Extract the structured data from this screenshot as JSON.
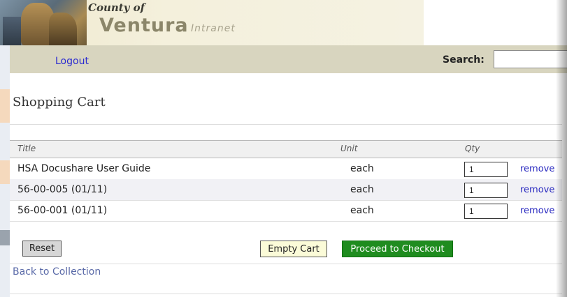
{
  "header": {
    "county": "County of",
    "ventura": "Ventura",
    "intranet": "Intranet"
  },
  "nav": {
    "logout": "Logout",
    "search_label": "Search:",
    "search_value": ""
  },
  "page": {
    "title": "Shopping Cart"
  },
  "table": {
    "headers": {
      "title": "Title",
      "unit": "Unit",
      "qty": "Qty"
    },
    "rows": [
      {
        "title": "HSA Docushare User Guide",
        "unit": "each",
        "qty": "1",
        "remove": "remove"
      },
      {
        "title": "56-00-005 (01/11)",
        "unit": "each",
        "qty": "1",
        "remove": "remove"
      },
      {
        "title": "56-00-001 (01/11)",
        "unit": "each",
        "qty": "1",
        "remove": "remove"
      }
    ]
  },
  "buttons": {
    "reset": "Reset",
    "empty_cart": "Empty Cart",
    "checkout": "Proceed to Checkout"
  },
  "links": {
    "back": "Back to Collection"
  },
  "colors": {
    "navbar": "#d8d5bf",
    "checkout": "#1f8c1f",
    "link": "#2a2ac0"
  }
}
